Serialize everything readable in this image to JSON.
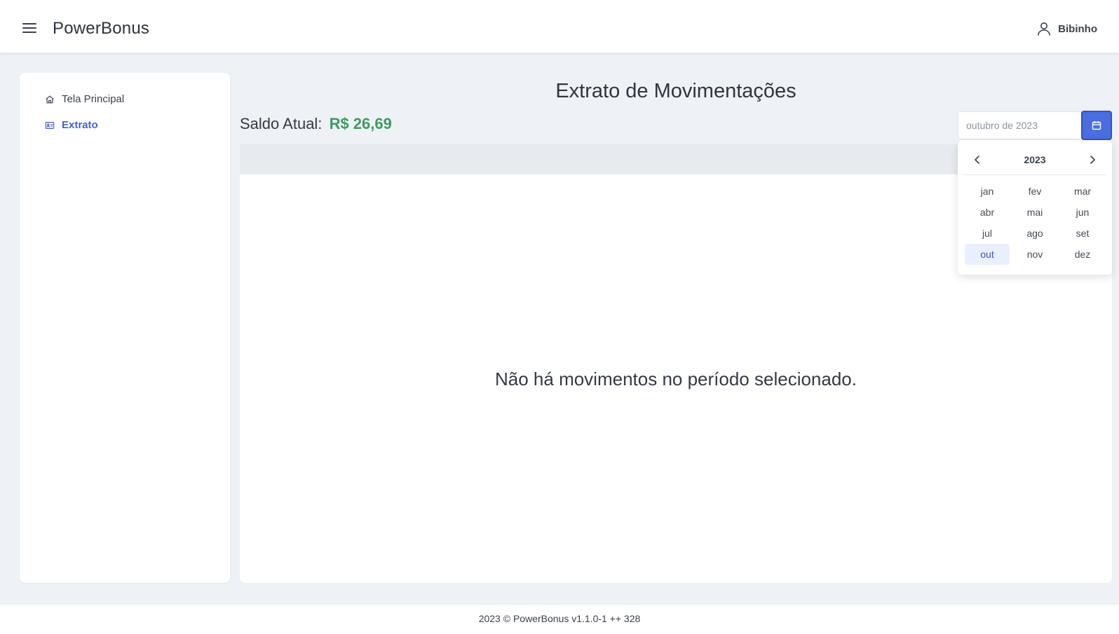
{
  "header": {
    "brand": "PowerBonus",
    "user_name": "Bibinho"
  },
  "sidebar": {
    "items": [
      {
        "label": "Tela Principal",
        "icon": "home-icon",
        "active": false
      },
      {
        "label": "Extrato",
        "icon": "id-card-icon",
        "active": true
      }
    ]
  },
  "main": {
    "title": "Extrato de Movimentações",
    "saldo_label": "Saldo Atual:",
    "saldo_value": "R$ 26,69",
    "month_input_value": "outubro de 2023",
    "empty_message": "Não há movimentos no período selecionado."
  },
  "picker": {
    "year": "2023",
    "months": [
      "jan",
      "fev",
      "mar",
      "abr",
      "mai",
      "jun",
      "jul",
      "ago",
      "set",
      "out",
      "nov",
      "dez"
    ],
    "selected": "out"
  },
  "footer": {
    "text": "2023 © PowerBonus v1.1.0-1 ++ 328"
  },
  "colors": {
    "accent": "#4a6ee0",
    "saldo_green": "#3f9a5f",
    "background": "#eef2f6"
  }
}
